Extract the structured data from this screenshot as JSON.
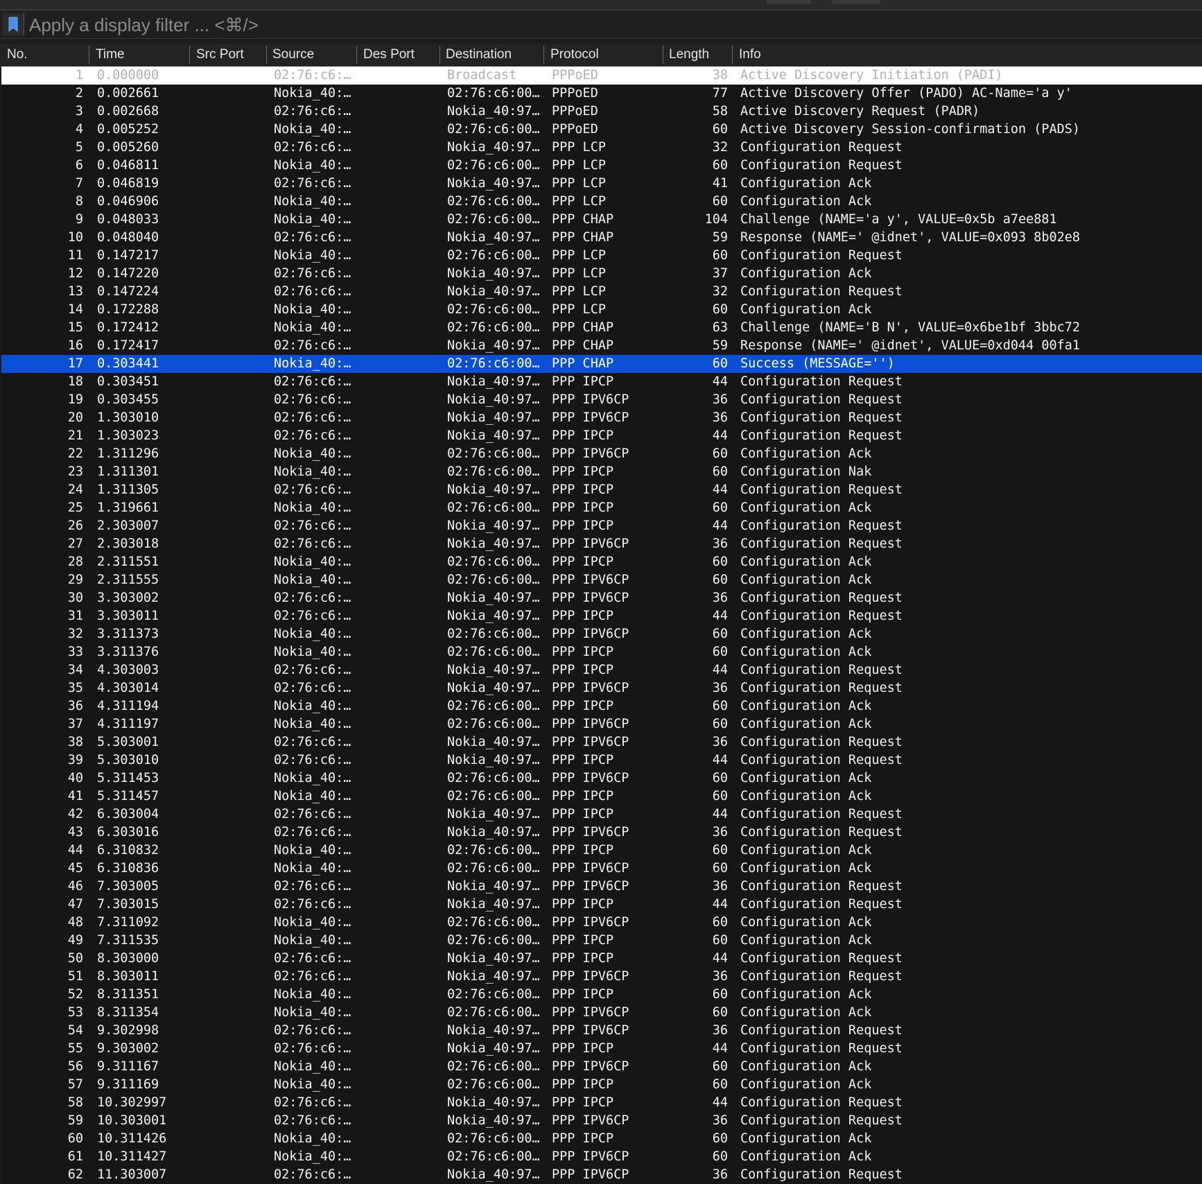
{
  "filter": {
    "placeholder": "Apply a display filter ... <⌘/>",
    "value": ""
  },
  "columns": [
    "No.",
    "Time",
    "Src Port",
    "Source",
    "Des Port",
    "Destination",
    "Protocol",
    "Length",
    "Info"
  ],
  "selected_row": 17,
  "colors": {
    "background": "#161616",
    "selected": "#0a4fd6",
    "header": "#232323"
  },
  "rows": [
    {
      "no": "1",
      "time": "0.000000",
      "src_port": "",
      "source": "02:76:c6:…",
      "des_port": "",
      "destination": "Broadcast",
      "protocol": "PPPoED",
      "length": "38",
      "info": "Active Discovery Initiation (PADI)"
    },
    {
      "no": "2",
      "time": "0.002661",
      "src_port": "",
      "source": "Nokia_40:…",
      "des_port": "",
      "destination": "02:76:c6:00…",
      "protocol": "PPPoED",
      "length": "77",
      "info": "Active Discovery Offer (PADO) AC-Name='a             y'"
    },
    {
      "no": "3",
      "time": "0.002668",
      "src_port": "",
      "source": "02:76:c6:…",
      "des_port": "",
      "destination": "Nokia_40:97…",
      "protocol": "PPPoED",
      "length": "58",
      "info": "Active Discovery Request (PADR)"
    },
    {
      "no": "4",
      "time": "0.005252",
      "src_port": "",
      "source": "Nokia_40:…",
      "des_port": "",
      "destination": "02:76:c6:00…",
      "protocol": "PPPoED",
      "length": "60",
      "info": "Active Discovery Session-confirmation (PADS)"
    },
    {
      "no": "5",
      "time": "0.005260",
      "src_port": "",
      "source": "02:76:c6:…",
      "des_port": "",
      "destination": "Nokia_40:97…",
      "protocol": "PPP LCP",
      "length": "32",
      "info": "Configuration Request"
    },
    {
      "no": "6",
      "time": "0.046811",
      "src_port": "",
      "source": "Nokia_40:…",
      "des_port": "",
      "destination": "02:76:c6:00…",
      "protocol": "PPP LCP",
      "length": "60",
      "info": "Configuration Request"
    },
    {
      "no": "7",
      "time": "0.046819",
      "src_port": "",
      "source": "02:76:c6:…",
      "des_port": "",
      "destination": "Nokia_40:97…",
      "protocol": "PPP LCP",
      "length": "41",
      "info": "Configuration Ack"
    },
    {
      "no": "8",
      "time": "0.046906",
      "src_port": "",
      "source": "Nokia_40:…",
      "des_port": "",
      "destination": "02:76:c6:00…",
      "protocol": "PPP LCP",
      "length": "60",
      "info": "Configuration Ack"
    },
    {
      "no": "9",
      "time": "0.048033",
      "src_port": "",
      "source": "Nokia_40:…",
      "des_port": "",
      "destination": "02:76:c6:00…",
      "protocol": "PPP CHAP",
      "length": "104",
      "info": "Challenge (NAME='a            y', VALUE=0x5b          a7ee881"
    },
    {
      "no": "10",
      "time": "0.048040",
      "src_port": "",
      "source": "02:76:c6:…",
      "des_port": "",
      "destination": "Nokia_40:97…",
      "protocol": "PPP CHAP",
      "length": "59",
      "info": "Response (NAME='         @idnet', VALUE=0x093          8b02e8"
    },
    {
      "no": "11",
      "time": "0.147217",
      "src_port": "",
      "source": "Nokia_40:…",
      "des_port": "",
      "destination": "02:76:c6:00…",
      "protocol": "PPP LCP",
      "length": "60",
      "info": "Configuration Request"
    },
    {
      "no": "12",
      "time": "0.147220",
      "src_port": "",
      "source": "02:76:c6:…",
      "des_port": "",
      "destination": "Nokia_40:97…",
      "protocol": "PPP LCP",
      "length": "37",
      "info": "Configuration Ack"
    },
    {
      "no": "13",
      "time": "0.147224",
      "src_port": "",
      "source": "02:76:c6:…",
      "des_port": "",
      "destination": "Nokia_40:97…",
      "protocol": "PPP LCP",
      "length": "32",
      "info": "Configuration Request"
    },
    {
      "no": "14",
      "time": "0.172288",
      "src_port": "",
      "source": "Nokia_40:…",
      "des_port": "",
      "destination": "02:76:c6:00…",
      "protocol": "PPP LCP",
      "length": "60",
      "info": "Configuration Ack"
    },
    {
      "no": "15",
      "time": "0.172412",
      "src_port": "",
      "source": "Nokia_40:…",
      "des_port": "",
      "destination": "02:76:c6:00…",
      "protocol": "PPP CHAP",
      "length": "63",
      "info": "Challenge (NAME='B          N', VALUE=0x6be1bf          3bbc72"
    },
    {
      "no": "16",
      "time": "0.172417",
      "src_port": "",
      "source": "02:76:c6:…",
      "des_port": "",
      "destination": "Nokia_40:97…",
      "protocol": "PPP CHAP",
      "length": "59",
      "info": "Response (NAME='         @idnet', VALUE=0xd044           00fa1"
    },
    {
      "no": "17",
      "time": "0.303441",
      "src_port": "",
      "source": "Nokia_40:…",
      "des_port": "",
      "destination": "02:76:c6:00…",
      "protocol": "PPP CHAP",
      "length": "60",
      "info": "Success (MESSAGE='')"
    },
    {
      "no": "18",
      "time": "0.303451",
      "src_port": "",
      "source": "02:76:c6:…",
      "des_port": "",
      "destination": "Nokia_40:97…",
      "protocol": "PPP IPCP",
      "length": "44",
      "info": "Configuration Request"
    },
    {
      "no": "19",
      "time": "0.303455",
      "src_port": "",
      "source": "02:76:c6:…",
      "des_port": "",
      "destination": "Nokia_40:97…",
      "protocol": "PPP IPV6CP",
      "length": "36",
      "info": "Configuration Request"
    },
    {
      "no": "20",
      "time": "1.303010",
      "src_port": "",
      "source": "02:76:c6:…",
      "des_port": "",
      "destination": "Nokia_40:97…",
      "protocol": "PPP IPV6CP",
      "length": "36",
      "info": "Configuration Request"
    },
    {
      "no": "21",
      "time": "1.303023",
      "src_port": "",
      "source": "02:76:c6:…",
      "des_port": "",
      "destination": "Nokia_40:97…",
      "protocol": "PPP IPCP",
      "length": "44",
      "info": "Configuration Request"
    },
    {
      "no": "22",
      "time": "1.311296",
      "src_port": "",
      "source": "Nokia_40:…",
      "des_port": "",
      "destination": "02:76:c6:00…",
      "protocol": "PPP IPV6CP",
      "length": "60",
      "info": "Configuration Ack"
    },
    {
      "no": "23",
      "time": "1.311301",
      "src_port": "",
      "source": "Nokia_40:…",
      "des_port": "",
      "destination": "02:76:c6:00…",
      "protocol": "PPP IPCP",
      "length": "60",
      "info": "Configuration Nak"
    },
    {
      "no": "24",
      "time": "1.311305",
      "src_port": "",
      "source": "02:76:c6:…",
      "des_port": "",
      "destination": "Nokia_40:97…",
      "protocol": "PPP IPCP",
      "length": "44",
      "info": "Configuration Request"
    },
    {
      "no": "25",
      "time": "1.319661",
      "src_port": "",
      "source": "Nokia_40:…",
      "des_port": "",
      "destination": "02:76:c6:00…",
      "protocol": "PPP IPCP",
      "length": "60",
      "info": "Configuration Ack"
    },
    {
      "no": "26",
      "time": "2.303007",
      "src_port": "",
      "source": "02:76:c6:…",
      "des_port": "",
      "destination": "Nokia_40:97…",
      "protocol": "PPP IPCP",
      "length": "44",
      "info": "Configuration Request"
    },
    {
      "no": "27",
      "time": "2.303018",
      "src_port": "",
      "source": "02:76:c6:…",
      "des_port": "",
      "destination": "Nokia_40:97…",
      "protocol": "PPP IPV6CP",
      "length": "36",
      "info": "Configuration Request"
    },
    {
      "no": "28",
      "time": "2.311551",
      "src_port": "",
      "source": "Nokia_40:…",
      "des_port": "",
      "destination": "02:76:c6:00…",
      "protocol": "PPP IPCP",
      "length": "60",
      "info": "Configuration Ack"
    },
    {
      "no": "29",
      "time": "2.311555",
      "src_port": "",
      "source": "Nokia_40:…",
      "des_port": "",
      "destination": "02:76:c6:00…",
      "protocol": "PPP IPV6CP",
      "length": "60",
      "info": "Configuration Ack"
    },
    {
      "no": "30",
      "time": "3.303002",
      "src_port": "",
      "source": "02:76:c6:…",
      "des_port": "",
      "destination": "Nokia_40:97…",
      "protocol": "PPP IPV6CP",
      "length": "36",
      "info": "Configuration Request"
    },
    {
      "no": "31",
      "time": "3.303011",
      "src_port": "",
      "source": "02:76:c6:…",
      "des_port": "",
      "destination": "Nokia_40:97…",
      "protocol": "PPP IPCP",
      "length": "44",
      "info": "Configuration Request"
    },
    {
      "no": "32",
      "time": "3.311373",
      "src_port": "",
      "source": "Nokia_40:…",
      "des_port": "",
      "destination": "02:76:c6:00…",
      "protocol": "PPP IPV6CP",
      "length": "60",
      "info": "Configuration Ack"
    },
    {
      "no": "33",
      "time": "3.311376",
      "src_port": "",
      "source": "Nokia_40:…",
      "des_port": "",
      "destination": "02:76:c6:00…",
      "protocol": "PPP IPCP",
      "length": "60",
      "info": "Configuration Ack"
    },
    {
      "no": "34",
      "time": "4.303003",
      "src_port": "",
      "source": "02:76:c6:…",
      "des_port": "",
      "destination": "Nokia_40:97…",
      "protocol": "PPP IPCP",
      "length": "44",
      "info": "Configuration Request"
    },
    {
      "no": "35",
      "time": "4.303014",
      "src_port": "",
      "source": "02:76:c6:…",
      "des_port": "",
      "destination": "Nokia_40:97…",
      "protocol": "PPP IPV6CP",
      "length": "36",
      "info": "Configuration Request"
    },
    {
      "no": "36",
      "time": "4.311194",
      "src_port": "",
      "source": "Nokia_40:…",
      "des_port": "",
      "destination": "02:76:c6:00…",
      "protocol": "PPP IPCP",
      "length": "60",
      "info": "Configuration Ack"
    },
    {
      "no": "37",
      "time": "4.311197",
      "src_port": "",
      "source": "Nokia_40:…",
      "des_port": "",
      "destination": "02:76:c6:00…",
      "protocol": "PPP IPV6CP",
      "length": "60",
      "info": "Configuration Ack"
    },
    {
      "no": "38",
      "time": "5.303001",
      "src_port": "",
      "source": "02:76:c6:…",
      "des_port": "",
      "destination": "Nokia_40:97…",
      "protocol": "PPP IPV6CP",
      "length": "36",
      "info": "Configuration Request"
    },
    {
      "no": "39",
      "time": "5.303010",
      "src_port": "",
      "source": "02:76:c6:…",
      "des_port": "",
      "destination": "Nokia_40:97…",
      "protocol": "PPP IPCP",
      "length": "44",
      "info": "Configuration Request"
    },
    {
      "no": "40",
      "time": "5.311453",
      "src_port": "",
      "source": "Nokia_40:…",
      "des_port": "",
      "destination": "02:76:c6:00…",
      "protocol": "PPP IPV6CP",
      "length": "60",
      "info": "Configuration Ack"
    },
    {
      "no": "41",
      "time": "5.311457",
      "src_port": "",
      "source": "Nokia_40:…",
      "des_port": "",
      "destination": "02:76:c6:00…",
      "protocol": "PPP IPCP",
      "length": "60",
      "info": "Configuration Ack"
    },
    {
      "no": "42",
      "time": "6.303004",
      "src_port": "",
      "source": "02:76:c6:…",
      "des_port": "",
      "destination": "Nokia_40:97…",
      "protocol": "PPP IPCP",
      "length": "44",
      "info": "Configuration Request"
    },
    {
      "no": "43",
      "time": "6.303016",
      "src_port": "",
      "source": "02:76:c6:…",
      "des_port": "",
      "destination": "Nokia_40:97…",
      "protocol": "PPP IPV6CP",
      "length": "36",
      "info": "Configuration Request"
    },
    {
      "no": "44",
      "time": "6.310832",
      "src_port": "",
      "source": "Nokia_40:…",
      "des_port": "",
      "destination": "02:76:c6:00…",
      "protocol": "PPP IPCP",
      "length": "60",
      "info": "Configuration Ack"
    },
    {
      "no": "45",
      "time": "6.310836",
      "src_port": "",
      "source": "Nokia_40:…",
      "des_port": "",
      "destination": "02:76:c6:00…",
      "protocol": "PPP IPV6CP",
      "length": "60",
      "info": "Configuration Ack"
    },
    {
      "no": "46",
      "time": "7.303005",
      "src_port": "",
      "source": "02:76:c6:…",
      "des_port": "",
      "destination": "Nokia_40:97…",
      "protocol": "PPP IPV6CP",
      "length": "36",
      "info": "Configuration Request"
    },
    {
      "no": "47",
      "time": "7.303015",
      "src_port": "",
      "source": "02:76:c6:…",
      "des_port": "",
      "destination": "Nokia_40:97…",
      "protocol": "PPP IPCP",
      "length": "44",
      "info": "Configuration Request"
    },
    {
      "no": "48",
      "time": "7.311092",
      "src_port": "",
      "source": "Nokia_40:…",
      "des_port": "",
      "destination": "02:76:c6:00…",
      "protocol": "PPP IPV6CP",
      "length": "60",
      "info": "Configuration Ack"
    },
    {
      "no": "49",
      "time": "7.311535",
      "src_port": "",
      "source": "Nokia_40:…",
      "des_port": "",
      "destination": "02:76:c6:00…",
      "protocol": "PPP IPCP",
      "length": "60",
      "info": "Configuration Ack"
    },
    {
      "no": "50",
      "time": "8.303000",
      "src_port": "",
      "source": "02:76:c6:…",
      "des_port": "",
      "destination": "Nokia_40:97…",
      "protocol": "PPP IPCP",
      "length": "44",
      "info": "Configuration Request"
    },
    {
      "no": "51",
      "time": "8.303011",
      "src_port": "",
      "source": "02:76:c6:…",
      "des_port": "",
      "destination": "Nokia_40:97…",
      "protocol": "PPP IPV6CP",
      "length": "36",
      "info": "Configuration Request"
    },
    {
      "no": "52",
      "time": "8.311351",
      "src_port": "",
      "source": "Nokia_40:…",
      "des_port": "",
      "destination": "02:76:c6:00…",
      "protocol": "PPP IPCP",
      "length": "60",
      "info": "Configuration Ack"
    },
    {
      "no": "53",
      "time": "8.311354",
      "src_port": "",
      "source": "Nokia_40:…",
      "des_port": "",
      "destination": "02:76:c6:00…",
      "protocol": "PPP IPV6CP",
      "length": "60",
      "info": "Configuration Ack"
    },
    {
      "no": "54",
      "time": "9.302998",
      "src_port": "",
      "source": "02:76:c6:…",
      "des_port": "",
      "destination": "Nokia_40:97…",
      "protocol": "PPP IPV6CP",
      "length": "36",
      "info": "Configuration Request"
    },
    {
      "no": "55",
      "time": "9.303002",
      "src_port": "",
      "source": "02:76:c6:…",
      "des_port": "",
      "destination": "Nokia_40:97…",
      "protocol": "PPP IPCP",
      "length": "44",
      "info": "Configuration Request"
    },
    {
      "no": "56",
      "time": "9.311167",
      "src_port": "",
      "source": "Nokia_40:…",
      "des_port": "",
      "destination": "02:76:c6:00…",
      "protocol": "PPP IPV6CP",
      "length": "60",
      "info": "Configuration Ack"
    },
    {
      "no": "57",
      "time": "9.311169",
      "src_port": "",
      "source": "Nokia_40:…",
      "des_port": "",
      "destination": "02:76:c6:00…",
      "protocol": "PPP IPCP",
      "length": "60",
      "info": "Configuration Ack"
    },
    {
      "no": "58",
      "time": "10.302997",
      "src_port": "",
      "source": "02:76:c6:…",
      "des_port": "",
      "destination": "Nokia_40:97…",
      "protocol": "PPP IPCP",
      "length": "44",
      "info": "Configuration Request"
    },
    {
      "no": "59",
      "time": "10.303001",
      "src_port": "",
      "source": "02:76:c6:…",
      "des_port": "",
      "destination": "Nokia_40:97…",
      "protocol": "PPP IPV6CP",
      "length": "36",
      "info": "Configuration Request"
    },
    {
      "no": "60",
      "time": "10.311426",
      "src_port": "",
      "source": "Nokia_40:…",
      "des_port": "",
      "destination": "02:76:c6:00…",
      "protocol": "PPP IPCP",
      "length": "60",
      "info": "Configuration Ack"
    },
    {
      "no": "61",
      "time": "10.311427",
      "src_port": "",
      "source": "Nokia_40:…",
      "des_port": "",
      "destination": "02:76:c6:00…",
      "protocol": "PPP IPV6CP",
      "length": "60",
      "info": "Configuration Ack"
    },
    {
      "no": "62",
      "time": "11.303007",
      "src_port": "",
      "source": "02:76:c6:…",
      "des_port": "",
      "destination": "Nokia_40:97…",
      "protocol": "PPP IPV6CP",
      "length": "36",
      "info": "Configuration Request"
    }
  ]
}
